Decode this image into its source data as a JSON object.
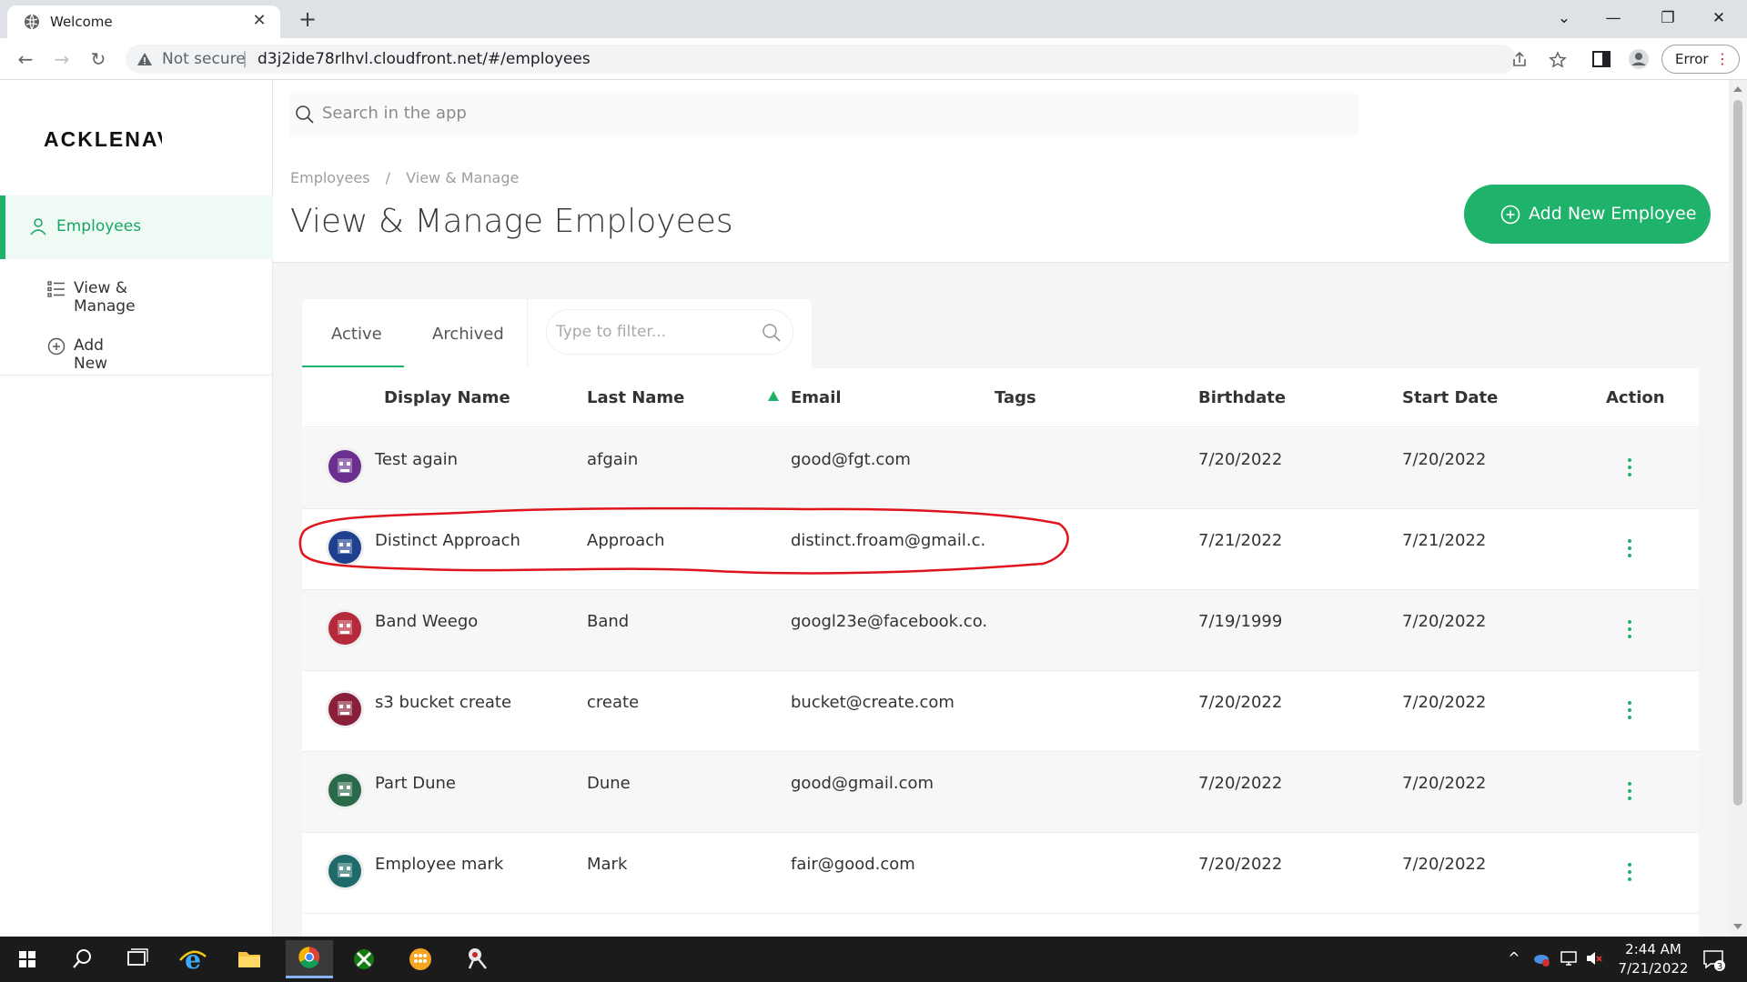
{
  "browser": {
    "tab_title": "Welcome",
    "security_label": "Not secure",
    "url": "d3j2ide78rlhvl.cloudfront.net/#/employees",
    "profile_chip": "Error"
  },
  "app": {
    "logo_text": "ACKLENAVE",
    "search_placeholder": "Search in the app",
    "sidebar": {
      "active": "Employees",
      "items": [
        "View & Manage",
        "Add New"
      ]
    },
    "breadcrumb": [
      "Employees",
      "/",
      "View & Manage"
    ],
    "page_title": "View & Manage Employees",
    "add_button": "Add New Employee",
    "tabs": [
      "Active",
      "Archived"
    ],
    "filter_placeholder": "Type to filter...",
    "columns": [
      "Display Name",
      "Last Name",
      "Email",
      "Tags",
      "Birthdate",
      "Start Date",
      "Action"
    ],
    "rows": [
      {
        "display_name": "Test again",
        "last_name": "afgain",
        "email": "good@fgt.com",
        "tags": "",
        "birthdate": "7/20/2022",
        "start_date": "7/20/2022",
        "avatar_color": "#6a2f8f"
      },
      {
        "display_name": "Distinct Approach",
        "last_name": "Approach",
        "email": "distinct.froam@gmail.c...",
        "tags": "",
        "birthdate": "7/21/2022",
        "start_date": "7/21/2022",
        "avatar_color": "#1f3f8f"
      },
      {
        "display_name": "Band Weego",
        "last_name": "Band",
        "email": "googl23e@facebook.co...",
        "tags": "",
        "birthdate": "7/19/1999",
        "start_date": "7/20/2022",
        "avatar_color": "#b52a3a"
      },
      {
        "display_name": "s3 bucket create",
        "last_name": "create",
        "email": "bucket@create.com",
        "tags": "",
        "birthdate": "7/20/2022",
        "start_date": "7/20/2022",
        "avatar_color": "#8a1f3a"
      },
      {
        "display_name": "Part Dune",
        "last_name": "Dune",
        "email": "good@gmail.com",
        "tags": "",
        "birthdate": "7/20/2022",
        "start_date": "7/20/2022",
        "avatar_color": "#2a6a4a"
      },
      {
        "display_name": "Employee mark",
        "last_name": "Mark",
        "email": "fair@good.com",
        "tags": "",
        "birthdate": "7/20/2022",
        "start_date": "7/20/2022",
        "avatar_color": "#1f6a6a"
      }
    ],
    "accent_color": "#1fb26a"
  },
  "taskbar": {
    "time": "2:44 AM",
    "date": "7/21/2022",
    "notification_count": "3"
  }
}
